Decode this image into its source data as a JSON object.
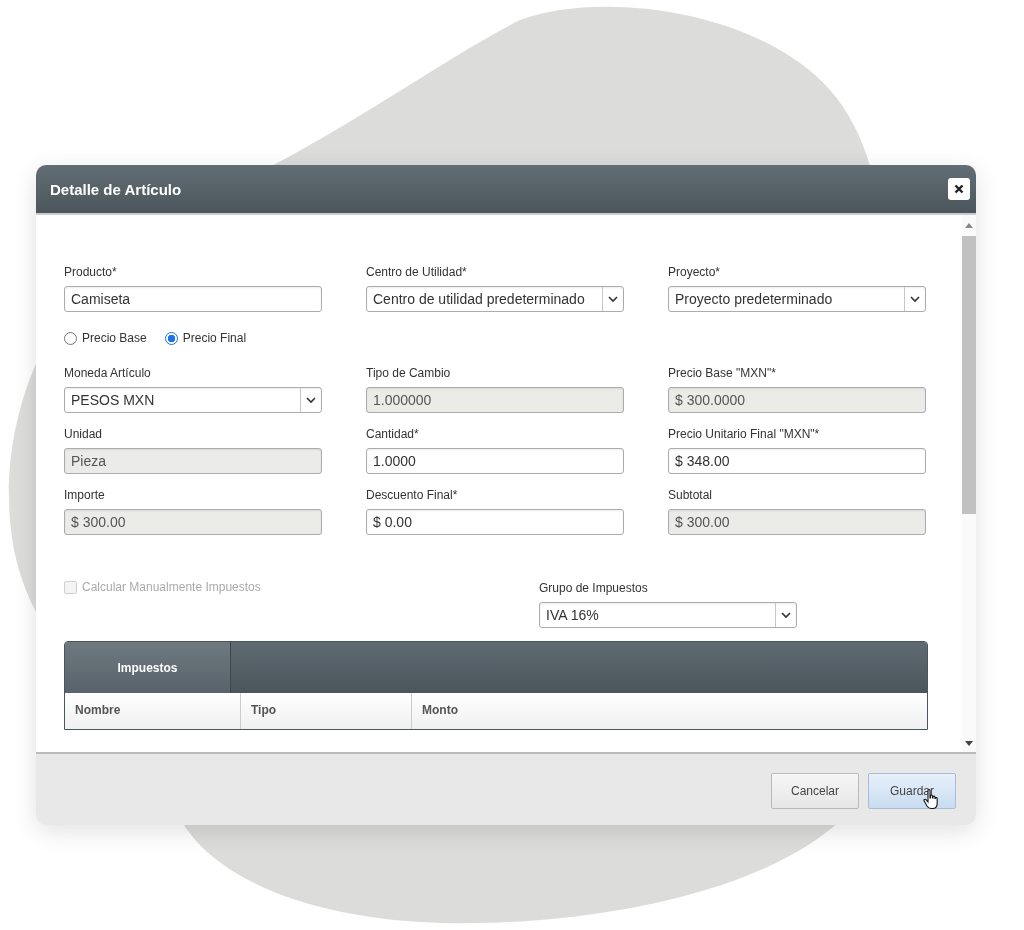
{
  "dialog": {
    "title": "Detalle de Artículo"
  },
  "top_fields": [
    {
      "label": "Producto*",
      "value": "Camiseta",
      "kind": "text"
    },
    {
      "label": "Centro de Utilidad*",
      "value": "Centro de utilidad predeterminado",
      "kind": "select"
    },
    {
      "label": "Proyecto*",
      "value": "Proyecto predeterminado",
      "kind": "select"
    }
  ],
  "price_mode": [
    {
      "label": "Precio Base",
      "selected": false
    },
    {
      "label": "Precio Final",
      "selected": true
    }
  ],
  "fields": [
    {
      "label": "Moneda Artículo",
      "value": "PESOS MXN",
      "kind": "select"
    },
    {
      "label": "Tipo de Cambio",
      "value": "1.000000",
      "kind": "readonly"
    },
    {
      "label": "Precio Base \"MXN\"*",
      "value": "$ 300.0000",
      "kind": "readonly"
    },
    {
      "label": "Unidad",
      "value": "Pieza",
      "kind": "readonly"
    },
    {
      "label": "Cantidad*",
      "value": "1.0000",
      "kind": "text"
    },
    {
      "label": "Precio Unitario Final \"MXN\"*",
      "value": "$ 348.00",
      "kind": "text"
    },
    {
      "label": "Importe",
      "value": "$ 300.00",
      "kind": "readonly"
    },
    {
      "label": "Descuento Final*",
      "value": "$ 0.00",
      "kind": "text"
    },
    {
      "label": "Subtotal",
      "value": "$ 300.00",
      "kind": "readonly"
    }
  ],
  "manual_taxes": {
    "label": "Calcular Manualmente Impuestos",
    "checked": false,
    "disabled": true
  },
  "tax_group": {
    "label": "Grupo de Impuestos",
    "value": "IVA 16%",
    "kind": "select"
  },
  "tabs": [
    {
      "label": "Impuestos",
      "selected": true
    }
  ],
  "table": {
    "columns": [
      "Nombre",
      "Tipo",
      "Monto"
    ]
  },
  "buttons": [
    {
      "label": "Cancelar",
      "hovered": false
    },
    {
      "label": "Guardar",
      "hovered": true
    }
  ]
}
